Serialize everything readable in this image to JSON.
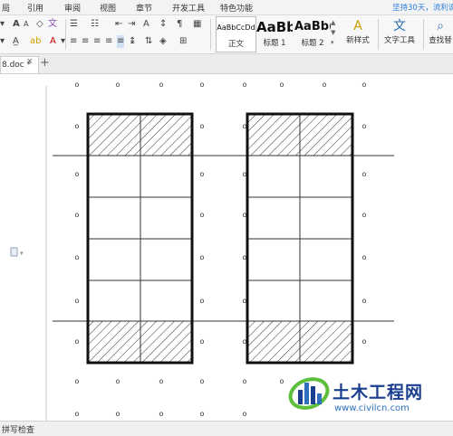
{
  "menu": {
    "items": [
      "局",
      "引用",
      "审阅",
      "视图",
      "章节",
      "开发工具",
      "特色功能"
    ],
    "promo": "坚持30天，流利说英"
  },
  "toolbar": {
    "styles": [
      {
        "preview": "AaBbCcDd",
        "label": "正文"
      },
      {
        "preview": "AaBb",
        "label": "标题 1"
      },
      {
        "preview": "AaBb(",
        "label": "标题 2"
      }
    ],
    "new_style_label": "新样式",
    "text_tools_label": "文字工具",
    "find_replace_label": "查找替"
  },
  "tabs": {
    "doc_name": "8.doc *",
    "close_glyph": "×",
    "add_glyph": "+"
  },
  "status": {
    "spellcheck": "拼写检查"
  },
  "drawing": {
    "marker_glyph": "o"
  },
  "watermark": {
    "name": "土木工程网",
    "url": "www.civilcn.com"
  },
  "colors": {
    "accent": "#2f7fd8",
    "watermark_blue": "#1a3f8f"
  }
}
